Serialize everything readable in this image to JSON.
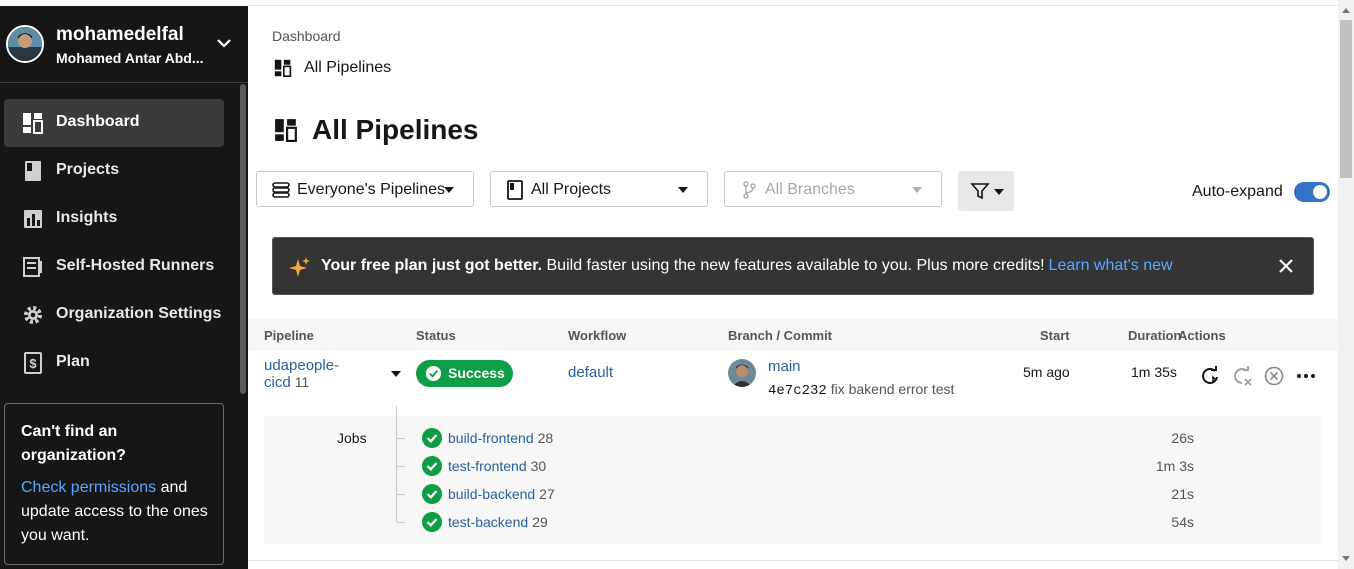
{
  "colors": {
    "sidebar_bg": "#161616",
    "success": "#0f9d45",
    "link": "#2a5f9e",
    "accent_toggle": "#3473c4",
    "banner_bg": "#343434"
  },
  "org": {
    "name": "mohamedelfal",
    "user": "Mohamed Antar Abd..."
  },
  "sidebar": {
    "items": [
      {
        "label": "Dashboard",
        "icon": "dashboard-icon",
        "active": true
      },
      {
        "label": "Projects",
        "icon": "projects-icon"
      },
      {
        "label": "Insights",
        "icon": "insights-icon"
      },
      {
        "label": "Self-Hosted Runners",
        "icon": "runners-icon"
      },
      {
        "label": "Organization Settings",
        "icon": "gear-icon"
      },
      {
        "label": "Plan",
        "icon": "plan-dollar-icon"
      }
    ],
    "find_org": {
      "title": "Can't find an organization?",
      "link": "Check permissions",
      "text_after": " and update access to the ones you want."
    }
  },
  "breadcrumb": {
    "root": "Dashboard",
    "current": "All Pipelines"
  },
  "page_title": "All Pipelines",
  "filters": {
    "pipelines": "Everyone's Pipelines",
    "projects": "All Projects",
    "branches": "All Branches",
    "auto_expand_label": "Auto-expand",
    "auto_expand_on": true
  },
  "banner": {
    "bold": "Your free plan just got better.",
    "text": " Build faster using the new features available to you. Plus more credits!",
    "link": "Learn what's new"
  },
  "table": {
    "headers": {
      "pipeline": "Pipeline",
      "status": "Status",
      "workflow": "Workflow",
      "branch_commit": "Branch / Commit",
      "start": "Start",
      "duration": "Duration",
      "actions": "Actions"
    },
    "row": {
      "project_line1": "udapeople-",
      "project_line2": "cicd",
      "number": "11",
      "status": "Success",
      "workflow": "default",
      "branch": "main",
      "commit_sha": "4e7c232",
      "commit_msg": "fix bakend error test",
      "start": "5m ago",
      "duration": "1m 35s"
    },
    "jobs_label": "Jobs",
    "jobs": [
      {
        "name": "build-frontend",
        "number": "28",
        "duration": "26s"
      },
      {
        "name": "test-frontend",
        "number": "30",
        "duration": "1m 3s"
      },
      {
        "name": "build-backend",
        "number": "27",
        "duration": "21s"
      },
      {
        "name": "test-backend",
        "number": "29",
        "duration": "54s"
      }
    ]
  }
}
